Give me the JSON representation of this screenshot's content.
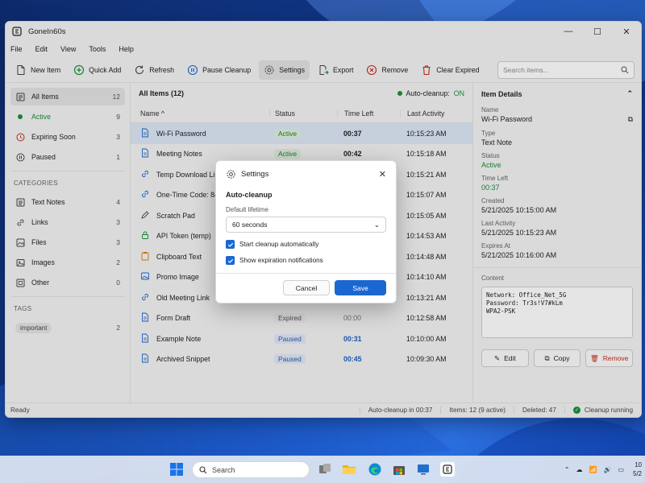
{
  "window": {
    "title": "GoneIn60s",
    "minimize": "—",
    "maximize": "☐",
    "close": "✕"
  },
  "menu": [
    "File",
    "Edit",
    "View",
    "Tools",
    "Help"
  ],
  "toolbar": {
    "new_item": "New Item",
    "quick_add": "Quick Add",
    "refresh": "Refresh",
    "pause_cleanup": "Pause Cleanup",
    "settings": "Settings",
    "export": "Export",
    "remove": "Remove",
    "clear_expired": "Clear Expired",
    "search_placeholder": "Search items..."
  },
  "sidebar": {
    "items": [
      {
        "label": "All Items",
        "count": "12"
      },
      {
        "label": "Active",
        "count": "9"
      },
      {
        "label": "Expiring Soon",
        "count": "3"
      },
      {
        "label": "Paused",
        "count": "1"
      }
    ],
    "categories_header": "CATEGORIES",
    "categories": [
      {
        "label": "Text Notes",
        "count": "4"
      },
      {
        "label": "Links",
        "count": "3"
      },
      {
        "label": "Files",
        "count": "3"
      },
      {
        "label": "Images",
        "count": "2"
      },
      {
        "label": "Other",
        "count": "0"
      }
    ],
    "tags_header": "TAGS",
    "tags": [
      {
        "label": "important",
        "count": "2"
      }
    ]
  },
  "list": {
    "title": "All Items (12)",
    "auto_cleanup_label": "Auto-cleanup:",
    "auto_cleanup_value": "ON",
    "columns": {
      "name": "Name ^",
      "status": "Status",
      "time_left": "Time Left",
      "last_activity": "Last Activity"
    },
    "rows": [
      {
        "name": "Wi-Fi Password",
        "status": "Active",
        "time": "00:37",
        "last": "10:15:23 AM",
        "icon": "document-icon"
      },
      {
        "name": "Meeting Notes",
        "status": "Active",
        "time": "00:42",
        "last": "10:15:18 AM",
        "icon": "document-icon"
      },
      {
        "name": "Temp Download Link",
        "status": "",
        "time": "",
        "last": "10:15:21 AM",
        "icon": "link-icon"
      },
      {
        "name": "One-Time Code: 84",
        "status": "",
        "time": "",
        "last": "10:15:07 AM",
        "icon": "link-icon"
      },
      {
        "name": "Scratch Pad",
        "status": "",
        "time": "",
        "last": "10:15:05 AM",
        "icon": "pencil-icon"
      },
      {
        "name": "API Token (temp)",
        "status": "",
        "time": "",
        "last": "10:14:53 AM",
        "icon": "lock-icon"
      },
      {
        "name": "Clipboard Text",
        "status": "",
        "time": "",
        "last": "10:14:48 AM",
        "icon": "clipboard-icon"
      },
      {
        "name": "Promo Image",
        "status": "",
        "time": "",
        "last": "10:14:10 AM",
        "icon": "image-icon"
      },
      {
        "name": "Old Meeting Link",
        "status": "",
        "time": "",
        "last": "10:13:21 AM",
        "icon": "link-icon"
      },
      {
        "name": "Form Draft",
        "status": "Expired",
        "time": "00:00",
        "last": "10:12:58 AM",
        "icon": "document-icon"
      },
      {
        "name": "Example Note",
        "status": "Paused",
        "time": "00:31",
        "last": "10:10:00 AM",
        "icon": "document-icon"
      },
      {
        "name": "Archived Snippet",
        "status": "Paused",
        "time": "00:45",
        "last": "10:09:30 AM",
        "icon": "document-icon"
      }
    ]
  },
  "details": {
    "header": "Item Details",
    "name_label": "Name",
    "name": "Wi-Fi Password",
    "type_label": "Type",
    "type": "Text Note",
    "status_label": "Status",
    "status": "Active",
    "time_left_label": "Time Left",
    "time_left": "00:37",
    "created_label": "Created",
    "created": "5/21/2025 10:15:00 AM",
    "last_activity_label": "Last Activity",
    "last_activity": "5/21/2025 10:15:23 AM",
    "expires_label": "Expires At",
    "expires": "5/21/2025 10:16:00 AM",
    "content_label": "Content",
    "content": "Network: Office_Net_5G\nPassword: Tr3s!V7#kLm\nWPA2-PSK",
    "edit": "Edit",
    "copy": "Copy",
    "remove": "Remove"
  },
  "statusbar": {
    "ready": "Ready",
    "auto_cleanup": "Auto-cleanup in 00:37",
    "items": "Items: 12 (9 active)",
    "deleted": "Deleted: 47",
    "running": "Cleanup running"
  },
  "modal": {
    "title": "Settings",
    "section": "Auto-cleanup",
    "lifetime_label": "Default lifetime",
    "lifetime_value": "60 seconds",
    "check1": "Start cleanup automatically",
    "check2": "Show expiration notifications",
    "cancel": "Cancel",
    "save": "Save"
  },
  "taskbar": {
    "search": "Search",
    "clock_time": "10",
    "clock_date": "5/2"
  },
  "colors": {
    "accent": "#1a67d2",
    "active_green": "#1a8f3a",
    "danger": "#c42b1c"
  }
}
